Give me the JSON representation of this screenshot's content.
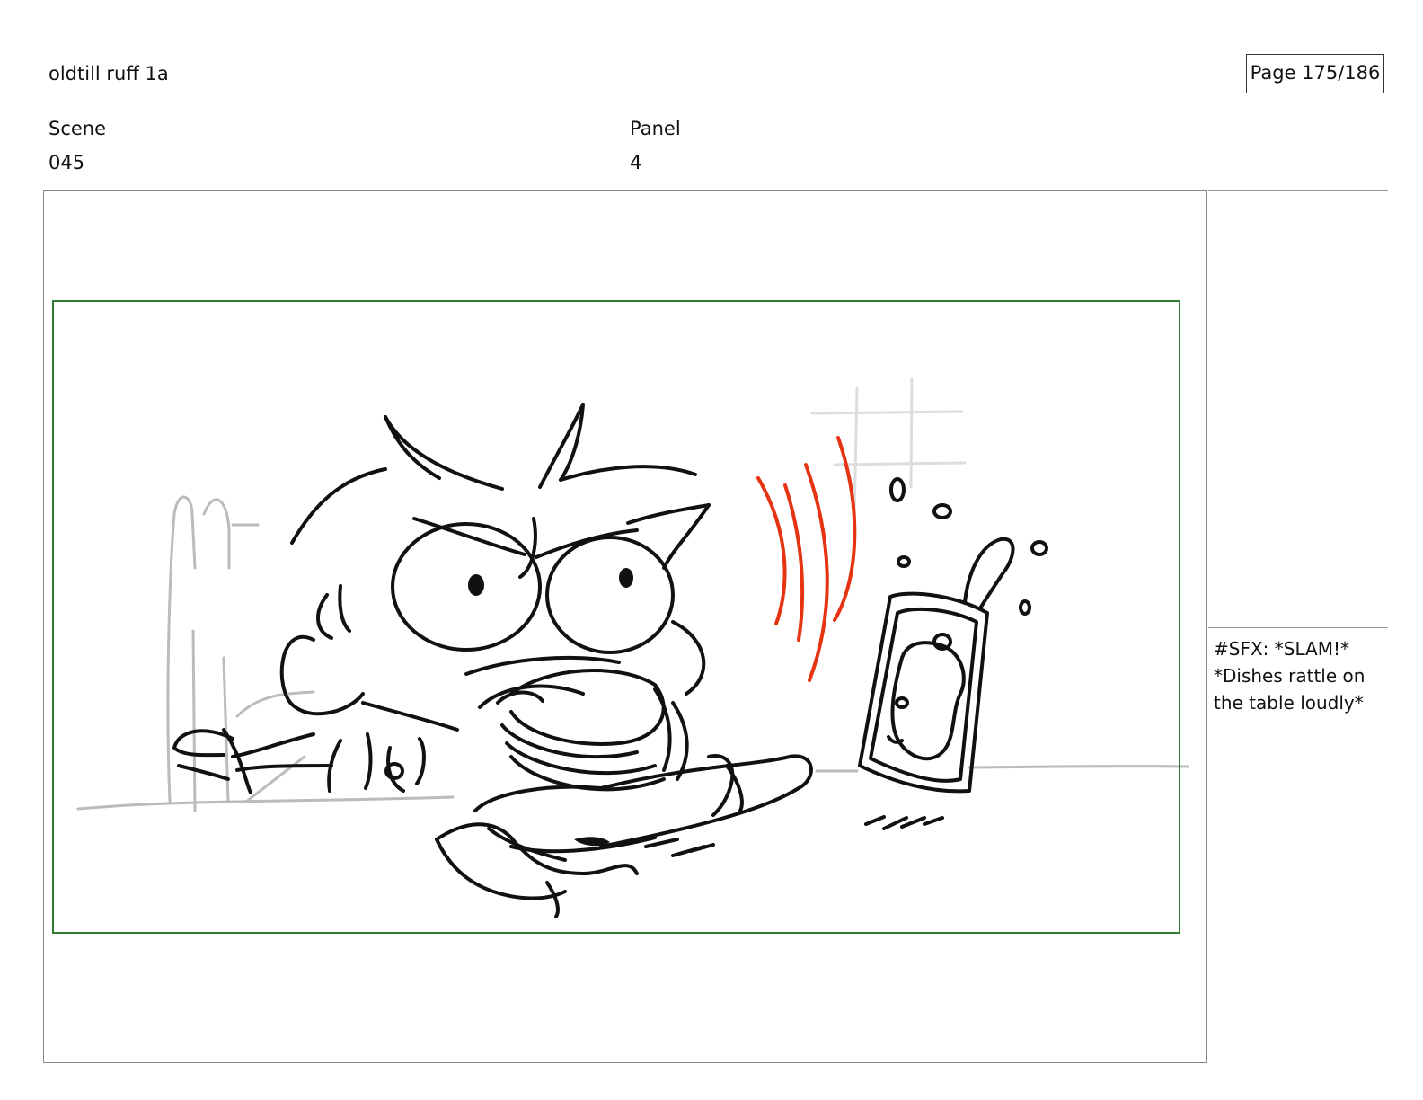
{
  "header": {
    "title": "oldtill ruff 1a",
    "page": "Page 175/186"
  },
  "fields": {
    "scene_label": "Scene",
    "scene_value": "045",
    "panel_label": "Panel",
    "panel_value": "4"
  },
  "notes": {
    "lines": [
      "#SFX: *SLAM!*",
      "*Dishes rattle on",
      "the table loudly*"
    ]
  },
  "colors": {
    "safe_area_border": "#2e7d32",
    "sfx_lines": "#e63312",
    "sketch": "#111111",
    "construction": "#bbbbbb"
  }
}
